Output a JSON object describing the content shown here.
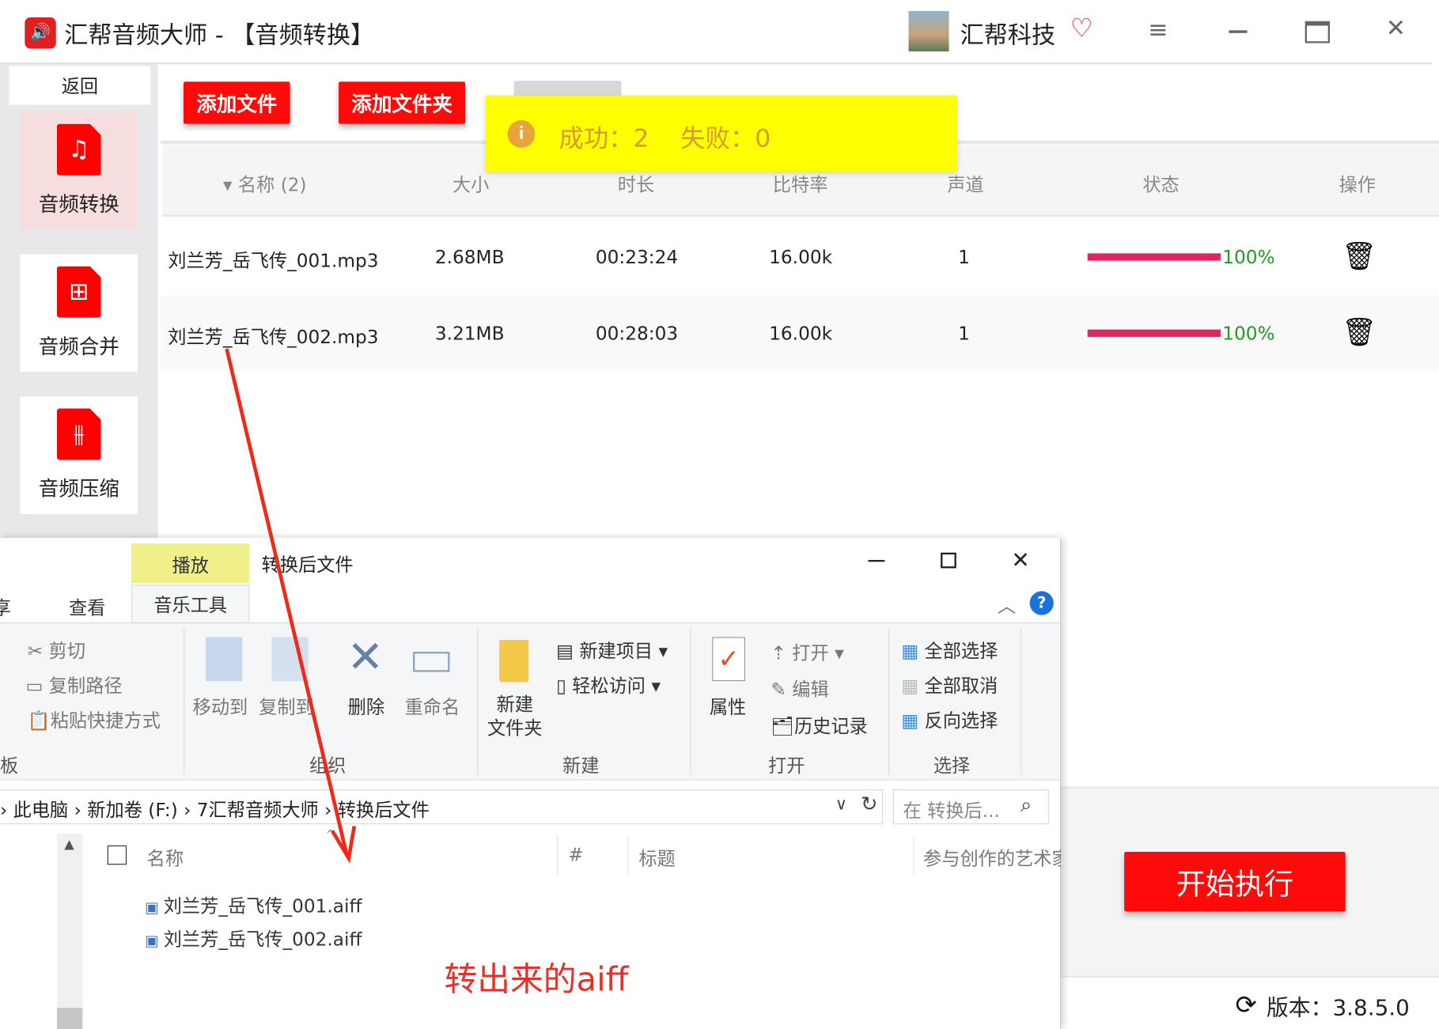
{
  "app": {
    "title": "汇帮音频大师 - 【音频转换】",
    "brand": "汇帮科技",
    "accent": "#ff0a0a"
  },
  "sidebar": {
    "back": "返回",
    "items": [
      {
        "label": "音频转换",
        "icon": "audio-convert-icon",
        "active": true
      },
      {
        "label": "音频合并",
        "icon": "audio-merge-icon"
      },
      {
        "label": "音频压缩",
        "icon": "audio-compress-icon"
      }
    ]
  },
  "toolbar": {
    "add_file": "添加文件",
    "add_folder": "添加文件夹"
  },
  "toast": {
    "text": "成功：2    失败：0",
    "bg": "#ffff00"
  },
  "table": {
    "headers": [
      "名称 (2)",
      "大小",
      "时长",
      "比特率",
      "声道",
      "状态",
      "操作"
    ],
    "rows": [
      {
        "name": "刘兰芳_岳飞传_001.mp3",
        "size": "2.68MB",
        "duration": "00:23:24",
        "bitrate": "16.00k",
        "channels": "1",
        "progress": 100,
        "progress_label": "100%"
      },
      {
        "name": "刘兰芳_岳飞传_002.mp3",
        "size": "3.21MB",
        "duration": "00:28:03",
        "bitrate": "16.00k",
        "channels": "1",
        "progress": 100,
        "progress_label": "100%"
      }
    ]
  },
  "start_button": "开始执行",
  "version": "版本：3.8.5.0",
  "explorer": {
    "context_tab": "播放",
    "title": "转换后文件",
    "tabs": [
      "享",
      "查看",
      "音乐工具"
    ],
    "clipboard": {
      "cut": "剪切",
      "copy_path": "复制路径",
      "paste_shortcut": "粘贴快捷方式",
      "label": "板"
    },
    "organize": {
      "move_to": "移动到",
      "copy_to": "复制到",
      "delete": "删除",
      "rename": "重命名",
      "label": "组织"
    },
    "new": {
      "new_folder_1": "新建",
      "new_folder_2": "文件夹",
      "new_item": "新建项目",
      "easy_access": "轻松访问",
      "label": "新建"
    },
    "open": {
      "properties": "属性",
      "open": "打开",
      "edit": "编辑",
      "history": "历史记录",
      "label": "打开"
    },
    "select": {
      "select_all": "全部选择",
      "select_none": "全部取消",
      "invert": "反向选择",
      "label": "选择"
    },
    "breadcrumb": [
      "此电脑",
      "新加卷 (F:)",
      "7汇帮音频大师",
      "转换后文件"
    ],
    "search_placeholder": "在 转换后...",
    "columns": [
      "名称",
      "#",
      "标题",
      "参与创作的艺术家"
    ],
    "files": [
      "刘兰芳_岳飞传_001.aiff",
      "刘兰芳_岳飞传_002.aiff"
    ]
  },
  "annotation": "转出来的aiff"
}
